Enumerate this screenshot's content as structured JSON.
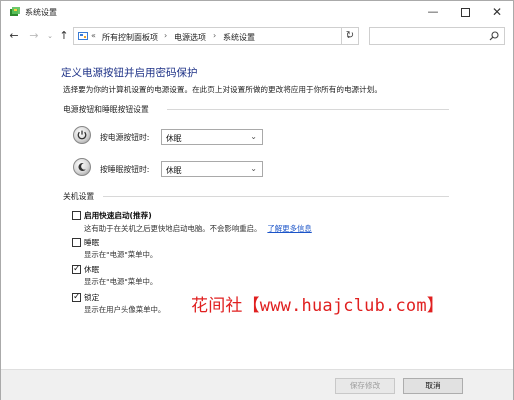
{
  "window": {
    "title": "系统设置"
  },
  "titlebar": {
    "min_glyph": "—",
    "close_glyph": "✕"
  },
  "nav": {
    "back_glyph": "←",
    "forward_glyph": "→",
    "dropdown_glyph": "⌄",
    "up_glyph": "↑",
    "chevron": "«",
    "breadcrumbs": [
      "所有控制面板项",
      "电源选项",
      "系统设置"
    ],
    "separator": "›",
    "address_dropdown_glyph": "⌄",
    "refresh_glyph": "↻",
    "search_placeholder": ""
  },
  "main": {
    "title": "定义电源按钮并启用密码保护",
    "description": "选择要为你的计算机设置的电源设置。在此页上对设置所做的更改将应用于你所有的电源计划。",
    "buttons_section": {
      "heading": "电源按钮和睡眠按钮设置",
      "rows": [
        {
          "label": "按电源按钮时:",
          "value": "休眠",
          "icon": "power-icon"
        },
        {
          "label": "按睡眠按钮时:",
          "value": "休眠",
          "icon": "sleep-icon"
        }
      ],
      "select_arrow": "⌄"
    },
    "shutdown_section": {
      "heading": "关机设置",
      "items": [
        {
          "label": "启用快速启动(推荐)",
          "checked": false,
          "bold": true,
          "desc": "这有助于在关机之后更快地启动电脑。不会影响重启。",
          "link": "了解更多信息"
        },
        {
          "label": "睡眠",
          "checked": false,
          "bold": false,
          "desc": "显示在\"电源\"菜单中。"
        },
        {
          "label": "休眠",
          "checked": true,
          "bold": false,
          "desc": "显示在\"电源\"菜单中。"
        },
        {
          "label": "锁定",
          "checked": true,
          "bold": false,
          "desc": "显示在用户头像菜单中。"
        }
      ],
      "check_glyph": "✓"
    }
  },
  "watermark": "花间社【www.huajclub.com】",
  "footer": {
    "save_label": "保存修改",
    "cancel_label": "取消"
  },
  "colors": {
    "title_blue": "#1e3287",
    "link_blue": "#1b54c8",
    "watermark_red": "#e02020"
  }
}
